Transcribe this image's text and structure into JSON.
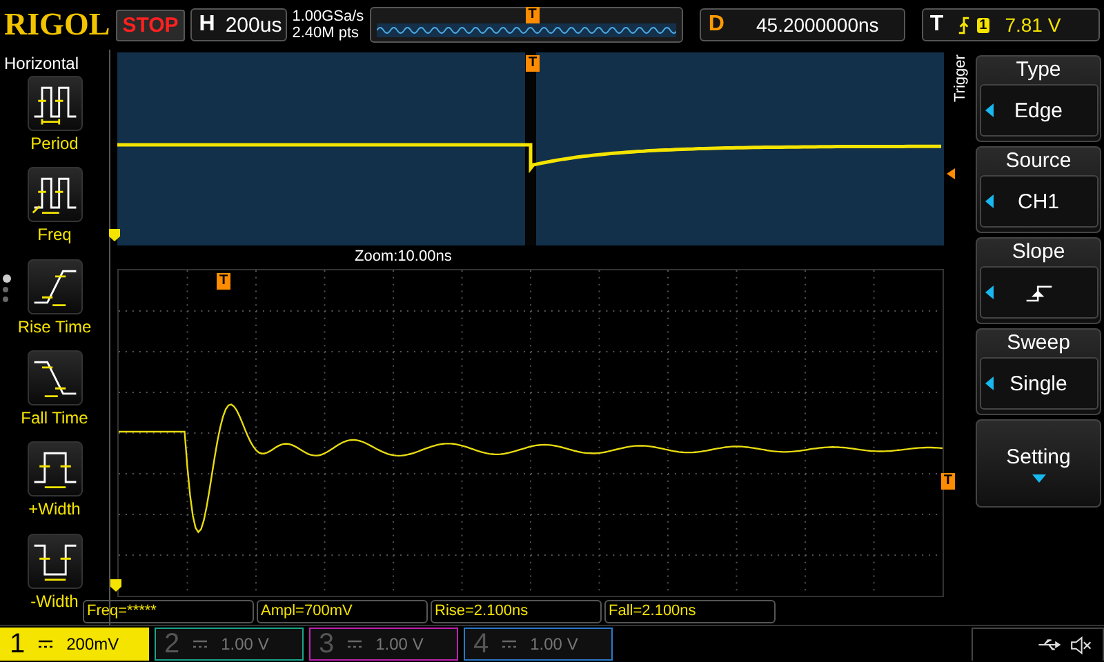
{
  "brand": "RIGOL",
  "run_state": {
    "label": "STOP",
    "kind": "stopped"
  },
  "timebase": {
    "key": "H",
    "value": "200us"
  },
  "sample_rate": "1.00GSa/s",
  "memory_depth": "2.40M pts",
  "position_marker": "T",
  "delay": {
    "key": "D",
    "value": "45.2000000ns"
  },
  "trigger": {
    "key": "T",
    "source": "1",
    "level": "7.81 V"
  },
  "sidebar": {
    "title": "Horizontal",
    "items": [
      {
        "label": "Period",
        "kind": "period"
      },
      {
        "label": "Freq",
        "kind": "freq"
      },
      {
        "label": "Rise Time",
        "kind": "rise"
      },
      {
        "label": "Fall Time",
        "kind": "fall"
      },
      {
        "label": "+Width",
        "kind": "pwidth"
      },
      {
        "label": "-Width",
        "kind": "nwidth"
      }
    ],
    "pages": [
      {
        "selected": true
      },
      {
        "selected": false
      },
      {
        "selected": false
      }
    ]
  },
  "overview": {
    "trigger_marker": "T"
  },
  "zoom_label": "Zoom:10.00ns",
  "zoom_view": {
    "trigger_marker": "T",
    "level_marker": "T"
  },
  "measurements": [
    "Freq=*****",
    "Ampl=700mV",
    "Rise=2.100ns",
    "Fall=2.100ns"
  ],
  "channels": [
    {
      "number": "1",
      "scale": "200mV",
      "on": true,
      "color": "#f5e400"
    },
    {
      "number": "2",
      "scale": "1.00 V",
      "on": false,
      "color": "#1aa58a"
    },
    {
      "number": "3",
      "scale": "1.00 V",
      "on": false,
      "color": "#c020b0"
    },
    {
      "number": "4",
      "scale": "1.00 V",
      "on": false,
      "color": "#2a78c8"
    }
  ],
  "menu": {
    "title": "Trigger",
    "items": [
      {
        "label": "Type",
        "value": "Edge",
        "kind": "select"
      },
      {
        "label": "Source",
        "value": "CH1",
        "kind": "select"
      },
      {
        "label": "Slope",
        "kind": "slope"
      },
      {
        "label": "Sweep",
        "value": "Single",
        "kind": "select"
      },
      {
        "label": "Setting",
        "kind": "submenu"
      }
    ]
  }
}
